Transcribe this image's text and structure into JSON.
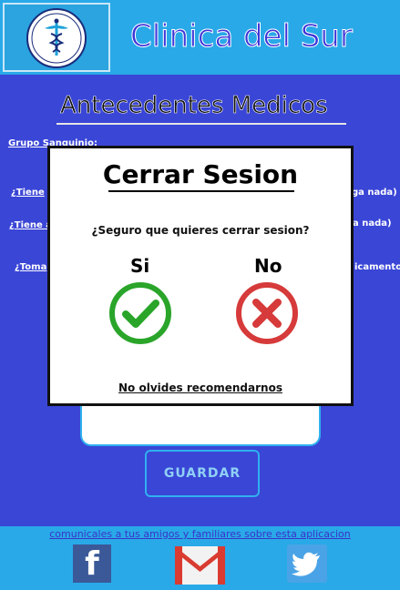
{
  "header": {
    "title": "Clinica del Sur"
  },
  "form": {
    "heading": "Antecedentes Medicos",
    "blood_type_label": "Grupo Sanguinio:",
    "q1_label": "¿Tiene",
    "q1_right": "ga nada)",
    "q2_label": "¿Tiene a",
    "q2_right": "a nada)",
    "q3_label": "¿Toma",
    "q3_right": "icamento",
    "save_label": "GUARDAR"
  },
  "modal": {
    "title": "Cerrar Sesion",
    "question": "¿Seguro que quieres cerrar sesion?",
    "yes_label": "Si",
    "no_label": "No",
    "recommend": "No olvides recomendarnos"
  },
  "footer": {
    "share_text": "comunicales a tus amigos y familiares sobre esta aplicacion",
    "facebook_glyph": "f"
  },
  "colors": {
    "background": "#3a46d6",
    "header": "#29a9e8",
    "yes": "#2aa52a",
    "no": "#d63a3a"
  }
}
